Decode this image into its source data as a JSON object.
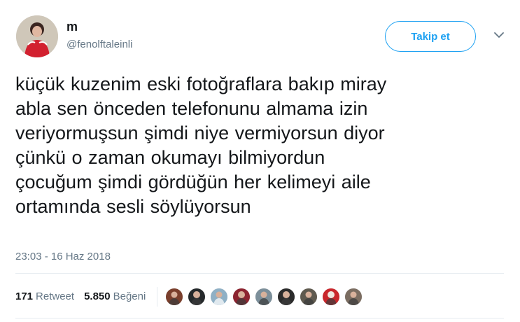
{
  "colors": {
    "primary_text": "#14171a",
    "secondary_text": "#657786",
    "accent": "#1da1f2",
    "divider": "#e6ecf0"
  },
  "author": {
    "display_name": "m",
    "username": "@fenolftaleinli",
    "avatar_icon": "profile-photo-avatar"
  },
  "actions": {
    "follow_label": "Takip et",
    "menu_icon": "chevron-down-icon"
  },
  "tweet": {
    "text": "küçük kuzenim eski fotoğraflara bakıp miray\nabla sen önceden telefonunu almama izin\nveriyormuşsun şimdi niye vermiyorsun diyor\nçünkü o zaman okumayı bilmiyordun\nçocuğum şimdi gördüğün her kelimeyi aile\nortamında sesli söylüyorsun",
    "timestamp": "23:03 - 16 Haz 2018"
  },
  "stats": {
    "retweets_count": "171",
    "retweets_label": "Retweet",
    "likes_count": "5.850",
    "likes_label": "Beğeni"
  },
  "likers": [
    {
      "avatar": "liker-avatar-1",
      "color": "#7a3f2c"
    },
    {
      "avatar": "liker-avatar-2",
      "color": "#25292b"
    },
    {
      "avatar": "liker-avatar-3",
      "color": "#8fb0c5"
    },
    {
      "avatar": "liker-avatar-4",
      "color": "#8c2430"
    },
    {
      "avatar": "liker-avatar-5",
      "color": "#7c8f9a"
    },
    {
      "avatar": "liker-avatar-6",
      "color": "#2b2b2b"
    },
    {
      "avatar": "liker-avatar-7",
      "color": "#5f5a4f"
    },
    {
      "avatar": "liker-avatar-8",
      "color": "#c9272c"
    },
    {
      "avatar": "liker-avatar-9",
      "color": "#7b6d61"
    }
  ]
}
